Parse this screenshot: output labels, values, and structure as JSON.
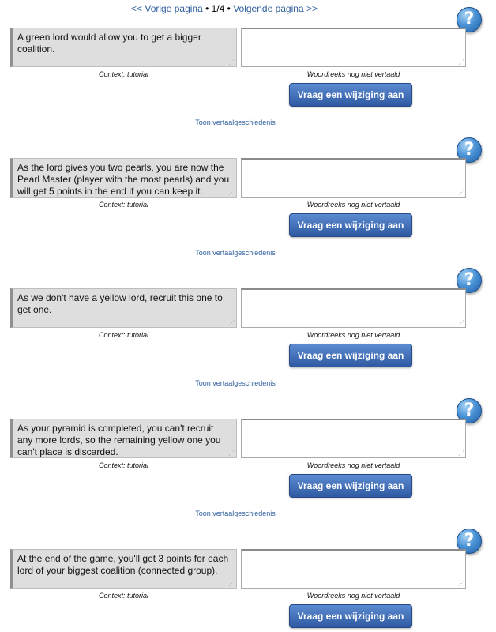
{
  "pager": {
    "prev": "<< Vorige pagina",
    "sep1": " • ",
    "current": "1/4",
    "sep2": " • ",
    "next": "Volgende pagina >>"
  },
  "help_icon": "question-icon",
  "button_label": "Vraag een wijziging aan",
  "history_label": "Toon vertaalgeschiedenis",
  "context_label": "Context: tutorial",
  "status_label": "Woordreeks nog niet vertaald",
  "entries": [
    {
      "source": "A green lord would allow you to get a bigger coalition."
    },
    {
      "source": "As the lord gives you two pearls, you are now the Pearl Master (player with the most pearls) and you will get 5 points in the end if you can keep it."
    },
    {
      "source": "As we don't have a yellow lord, recruit this one to get one."
    },
    {
      "source": "As your pyramid is completed, you can't recruit any more lords, so the remaining yellow one you can't place is discarded."
    },
    {
      "source": "At the end of the game, you'll get 3 points for each lord of your biggest coalition (connected group)."
    }
  ]
}
